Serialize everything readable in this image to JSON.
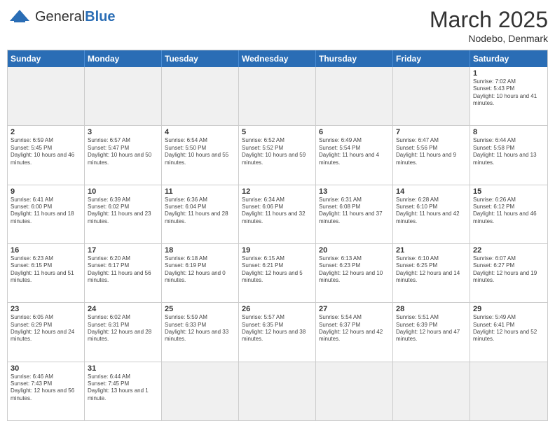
{
  "header": {
    "logo_general": "General",
    "logo_blue": "Blue",
    "month_title": "March 2025",
    "location": "Nodebo, Denmark"
  },
  "day_headers": [
    "Sunday",
    "Monday",
    "Tuesday",
    "Wednesday",
    "Thursday",
    "Friday",
    "Saturday"
  ],
  "rows": [
    [
      {
        "num": "",
        "info": "",
        "empty": true
      },
      {
        "num": "",
        "info": "",
        "empty": true
      },
      {
        "num": "",
        "info": "",
        "empty": true
      },
      {
        "num": "",
        "info": "",
        "empty": true
      },
      {
        "num": "",
        "info": "",
        "empty": true
      },
      {
        "num": "",
        "info": "",
        "empty": true
      },
      {
        "num": "1",
        "info": "Sunrise: 7:02 AM\nSunset: 5:43 PM\nDaylight: 10 hours and 41 minutes.",
        "empty": false
      }
    ],
    [
      {
        "num": "2",
        "info": "Sunrise: 6:59 AM\nSunset: 5:45 PM\nDaylight: 10 hours and 46 minutes.",
        "empty": false
      },
      {
        "num": "3",
        "info": "Sunrise: 6:57 AM\nSunset: 5:47 PM\nDaylight: 10 hours and 50 minutes.",
        "empty": false
      },
      {
        "num": "4",
        "info": "Sunrise: 6:54 AM\nSunset: 5:50 PM\nDaylight: 10 hours and 55 minutes.",
        "empty": false
      },
      {
        "num": "5",
        "info": "Sunrise: 6:52 AM\nSunset: 5:52 PM\nDaylight: 10 hours and 59 minutes.",
        "empty": false
      },
      {
        "num": "6",
        "info": "Sunrise: 6:49 AM\nSunset: 5:54 PM\nDaylight: 11 hours and 4 minutes.",
        "empty": false
      },
      {
        "num": "7",
        "info": "Sunrise: 6:47 AM\nSunset: 5:56 PM\nDaylight: 11 hours and 9 minutes.",
        "empty": false
      },
      {
        "num": "8",
        "info": "Sunrise: 6:44 AM\nSunset: 5:58 PM\nDaylight: 11 hours and 13 minutes.",
        "empty": false
      }
    ],
    [
      {
        "num": "9",
        "info": "Sunrise: 6:41 AM\nSunset: 6:00 PM\nDaylight: 11 hours and 18 minutes.",
        "empty": false
      },
      {
        "num": "10",
        "info": "Sunrise: 6:39 AM\nSunset: 6:02 PM\nDaylight: 11 hours and 23 minutes.",
        "empty": false
      },
      {
        "num": "11",
        "info": "Sunrise: 6:36 AM\nSunset: 6:04 PM\nDaylight: 11 hours and 28 minutes.",
        "empty": false
      },
      {
        "num": "12",
        "info": "Sunrise: 6:34 AM\nSunset: 6:06 PM\nDaylight: 11 hours and 32 minutes.",
        "empty": false
      },
      {
        "num": "13",
        "info": "Sunrise: 6:31 AM\nSunset: 6:08 PM\nDaylight: 11 hours and 37 minutes.",
        "empty": false
      },
      {
        "num": "14",
        "info": "Sunrise: 6:28 AM\nSunset: 6:10 PM\nDaylight: 11 hours and 42 minutes.",
        "empty": false
      },
      {
        "num": "15",
        "info": "Sunrise: 6:26 AM\nSunset: 6:12 PM\nDaylight: 11 hours and 46 minutes.",
        "empty": false
      }
    ],
    [
      {
        "num": "16",
        "info": "Sunrise: 6:23 AM\nSunset: 6:15 PM\nDaylight: 11 hours and 51 minutes.",
        "empty": false
      },
      {
        "num": "17",
        "info": "Sunrise: 6:20 AM\nSunset: 6:17 PM\nDaylight: 11 hours and 56 minutes.",
        "empty": false
      },
      {
        "num": "18",
        "info": "Sunrise: 6:18 AM\nSunset: 6:19 PM\nDaylight: 12 hours and 0 minutes.",
        "empty": false
      },
      {
        "num": "19",
        "info": "Sunrise: 6:15 AM\nSunset: 6:21 PM\nDaylight: 12 hours and 5 minutes.",
        "empty": false
      },
      {
        "num": "20",
        "info": "Sunrise: 6:13 AM\nSunset: 6:23 PM\nDaylight: 12 hours and 10 minutes.",
        "empty": false
      },
      {
        "num": "21",
        "info": "Sunrise: 6:10 AM\nSunset: 6:25 PM\nDaylight: 12 hours and 14 minutes.",
        "empty": false
      },
      {
        "num": "22",
        "info": "Sunrise: 6:07 AM\nSunset: 6:27 PM\nDaylight: 12 hours and 19 minutes.",
        "empty": false
      }
    ],
    [
      {
        "num": "23",
        "info": "Sunrise: 6:05 AM\nSunset: 6:29 PM\nDaylight: 12 hours and 24 minutes.",
        "empty": false
      },
      {
        "num": "24",
        "info": "Sunrise: 6:02 AM\nSunset: 6:31 PM\nDaylight: 12 hours and 28 minutes.",
        "empty": false
      },
      {
        "num": "25",
        "info": "Sunrise: 5:59 AM\nSunset: 6:33 PM\nDaylight: 12 hours and 33 minutes.",
        "empty": false
      },
      {
        "num": "26",
        "info": "Sunrise: 5:57 AM\nSunset: 6:35 PM\nDaylight: 12 hours and 38 minutes.",
        "empty": false
      },
      {
        "num": "27",
        "info": "Sunrise: 5:54 AM\nSunset: 6:37 PM\nDaylight: 12 hours and 42 minutes.",
        "empty": false
      },
      {
        "num": "28",
        "info": "Sunrise: 5:51 AM\nSunset: 6:39 PM\nDaylight: 12 hours and 47 minutes.",
        "empty": false
      },
      {
        "num": "29",
        "info": "Sunrise: 5:49 AM\nSunset: 6:41 PM\nDaylight: 12 hours and 52 minutes.",
        "empty": false
      }
    ],
    [
      {
        "num": "30",
        "info": "Sunrise: 6:46 AM\nSunset: 7:43 PM\nDaylight: 12 hours and 56 minutes.",
        "empty": false
      },
      {
        "num": "31",
        "info": "Sunrise: 6:44 AM\nSunset: 7:45 PM\nDaylight: 13 hours and 1 minute.",
        "empty": false
      },
      {
        "num": "",
        "info": "",
        "empty": true
      },
      {
        "num": "",
        "info": "",
        "empty": true
      },
      {
        "num": "",
        "info": "",
        "empty": true
      },
      {
        "num": "",
        "info": "",
        "empty": true
      },
      {
        "num": "",
        "info": "",
        "empty": true
      }
    ]
  ]
}
